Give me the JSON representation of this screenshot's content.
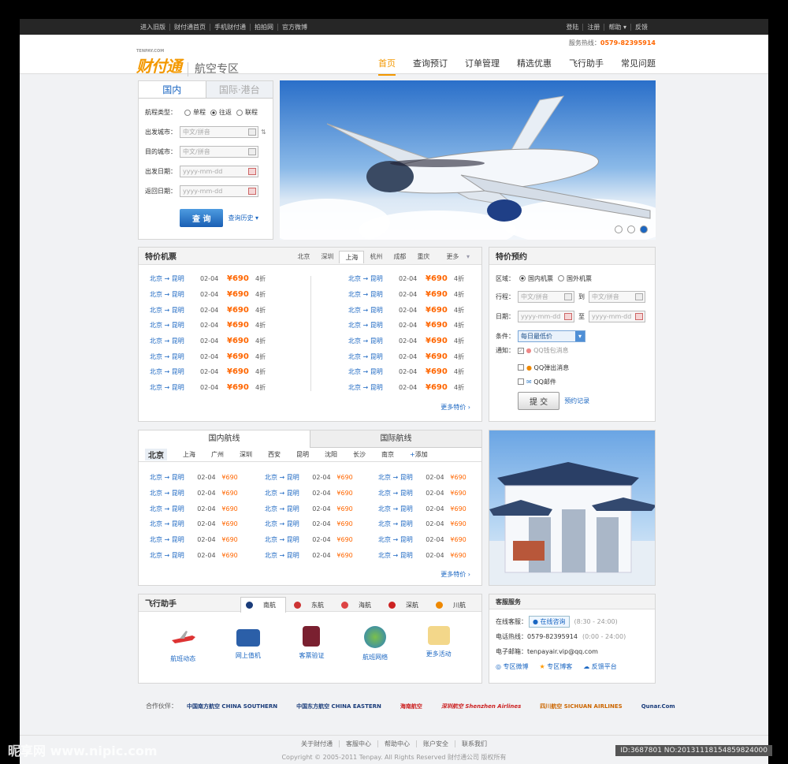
{
  "topbar": {
    "left": [
      "进入旧版",
      "财付通首页",
      "手机财付通",
      "拍拍网",
      "官方微博"
    ],
    "right": [
      "登陆",
      "注册",
      "帮助",
      "反馈"
    ]
  },
  "header": {
    "hotline_label": "服务热线：",
    "hotline": "0579-82395914",
    "logo_small": "TENPAY.COM",
    "logo": "财付通",
    "zone": "航空专区",
    "nav": [
      "首页",
      "查询预订",
      "订单管理",
      "精选优惠",
      "飞行助手",
      "常见问题"
    ]
  },
  "search": {
    "tab_domestic": "国内",
    "tab_intl": "国际·港台",
    "trip_label": "航程类型：",
    "trip_options": [
      "单程",
      "往返",
      "联程"
    ],
    "from_label": "出发城市：",
    "to_label": "目的城市：",
    "depart_label": "出发日期：",
    "return_label": "返回日期：",
    "city_ph": "中文/拼音",
    "date_ph": "yyyy-mm-dd",
    "submit": "查 询",
    "history": "查询历史"
  },
  "specials": {
    "title": "特价机票",
    "cities": [
      "北京",
      "深圳",
      "上海",
      "杭州",
      "成都",
      "重庆",
      "更多"
    ],
    "route": "北京 → 昆明",
    "date": "02-04",
    "price": "¥690",
    "discount": "4折",
    "more": "更多特价"
  },
  "reserve": {
    "title": "特价预约",
    "area_label": "区域：",
    "area_opts": [
      "国内机票",
      "国外机票"
    ],
    "trip_label": "行程：",
    "to": "到",
    "date_label": "日期：",
    "date_to": "至",
    "cond_label": "条件：",
    "cond": "每日最低价",
    "notify_label": "通知：",
    "notify": [
      "QQ钱包消息",
      "QQ弹出消息",
      "QQ邮件"
    ],
    "submit": "提 交",
    "records": "预约记录"
  },
  "routes": {
    "tab_domestic": "国内航线",
    "tab_intl": "国际航线",
    "cities": [
      "北京",
      "上海",
      "广州",
      "深圳",
      "西安",
      "昆明",
      "沈阳",
      "长沙",
      "南京"
    ],
    "add": "添加",
    "route": "北京 → 昆明",
    "date": "02-04",
    "price": "¥690",
    "more": "更多特价"
  },
  "helper": {
    "title": "飞行助手",
    "airlines": [
      "南航",
      "东航",
      "海航",
      "深航",
      "川航"
    ],
    "items": [
      "航班动态",
      "网上值机",
      "客票验证",
      "航班网络",
      "更多活动"
    ]
  },
  "service": {
    "title": "客服服务",
    "online_label": "在线客服：",
    "online_btn": "在线咨询",
    "online_hours": "(8:30 - 24:00)",
    "phone_label": "电话热线：",
    "phone": "0579-82395914",
    "phone_hours": "(0:00 - 24:00)",
    "email_label": "电子邮箱：",
    "email": "tenpayair.vip@qq.com",
    "links": [
      "专区微博",
      "专区博客",
      "反馈平台"
    ]
  },
  "partners": {
    "label": "合作伙伴：",
    "names": [
      "中国南方航空 CHINA SOUTHERN",
      "中国东方航空 CHINA EASTERN",
      "海南航空",
      "深圳航空 Shenzhen Airlines",
      "四川航空 SICHUAN AIRLINES",
      "Qunar.Com"
    ]
  },
  "footer": {
    "links": [
      "关于财付通",
      "客服中心",
      "帮助中心",
      "账户安全",
      "联系我们"
    ],
    "copyright": "Copyright © 2005-2011 Tenpay. All Rights Reserved 财付通公司 版权所有"
  },
  "watermark": {
    "left": "昵享网 www.nipic.com",
    "right": "ID:3687801 NO:20131118154859824000"
  }
}
